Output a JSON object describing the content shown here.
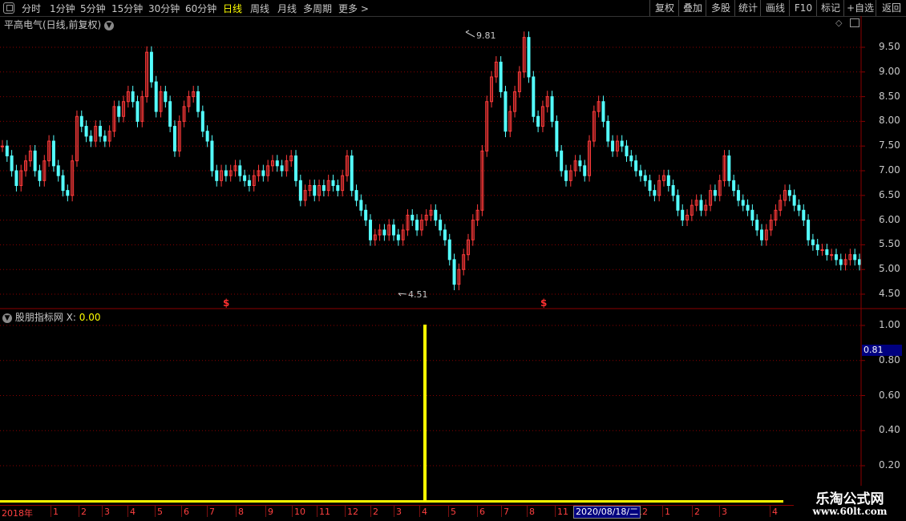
{
  "toolbar": {
    "periods": [
      "分时",
      "1分钟",
      "5分钟",
      "15分钟",
      "30分钟",
      "60分钟",
      "日线",
      "周线",
      "月线",
      "多周期",
      "更多 >"
    ],
    "active_period": "日线",
    "right_buttons": [
      "复权",
      "叠加",
      "多股",
      "统计",
      "画线",
      "F10",
      "标记",
      "+自选",
      "返回"
    ]
  },
  "main_chart": {
    "title": "平高电气(日线,前复权)",
    "y_ticks": [
      "9.50",
      "9.00",
      "8.50",
      "8.00",
      "7.50",
      "7.00",
      "6.50",
      "6.00",
      "5.50",
      "5.00",
      "4.50"
    ],
    "high_label": "9.81",
    "low_label": "4.51",
    "signal_marker": "$"
  },
  "indicator": {
    "title": "股朋指标网",
    "x_label": "X:",
    "x_value": "0.00",
    "y_ticks": [
      "1.00",
      "0.80",
      "0.60",
      "0.40",
      "0.20"
    ],
    "cursor_value": "0.81"
  },
  "x_axis": {
    "labels": [
      "2018年",
      "1",
      "2",
      "3",
      "4",
      "5",
      "6",
      "7",
      "8",
      "9",
      "10",
      "11",
      "12",
      "2",
      "3",
      "4",
      "5",
      "6",
      "7",
      "8",
      "11",
      "12",
      "1",
      "2",
      "3",
      "4"
    ],
    "cursor_date": "2020/08/18/二"
  },
  "watermark": {
    "line1": "乐淘公式网",
    "line2": "www.60lt.com"
  },
  "colors": {
    "up": "#ff3a3a",
    "down": "#54ffff",
    "grid": "#8b0000",
    "indicator": "#ffff00",
    "active": "#ffff00"
  },
  "chart_data": {
    "type": "candlestick",
    "title": "平高电气(日线,前复权)",
    "ylim": [
      4.3,
      9.9
    ],
    "close": [
      7.5,
      7.3,
      7.0,
      6.7,
      7.0,
      7.2,
      7.4,
      7.0,
      6.8,
      7.2,
      7.6,
      7.1,
      6.9,
      6.6,
      6.5,
      7.2,
      8.1,
      7.9,
      7.7,
      7.6,
      7.9,
      7.7,
      7.6,
      7.8,
      8.3,
      8.1,
      8.4,
      8.6,
      8.4,
      8.0,
      8.5,
      9.4,
      8.8,
      8.2,
      8.6,
      8.4,
      7.9,
      7.4,
      8.0,
      8.3,
      8.5,
      8.6,
      8.2,
      7.8,
      7.6,
      7.0,
      6.8,
      7.0,
      6.9,
      7.0,
      7.1,
      6.9,
      6.8,
      6.7,
      6.9,
      7.0,
      6.9,
      7.1,
      7.2,
      7.1,
      7.0,
      7.2,
      7.3,
      6.8,
      6.4,
      6.6,
      6.7,
      6.5,
      6.7,
      6.6,
      6.8,
      6.7,
      6.6,
      6.9,
      7.3,
      6.6,
      6.4,
      6.2,
      6.0,
      5.6,
      5.7,
      5.8,
      5.7,
      5.9,
      5.7,
      5.6,
      5.8,
      6.1,
      6.0,
      5.8,
      6.0,
      6.1,
      6.2,
      6.0,
      5.8,
      5.6,
      5.2,
      4.7,
      5.0,
      5.3,
      5.6,
      6.0,
      6.2,
      7.4,
      8.4,
      8.9,
      9.2,
      8.6,
      7.8,
      8.2,
      8.6,
      9.0,
      9.7,
      8.9,
      8.1,
      7.9,
      8.3,
      8.5,
      8.0,
      7.4,
      7.0,
      6.8,
      7.0,
      7.2,
      7.1,
      6.9,
      7.6,
      8.2,
      8.4,
      8.0,
      7.6,
      7.4,
      7.6,
      7.5,
      7.3,
      7.2,
      7.0,
      6.9,
      6.8,
      6.6,
      6.5,
      6.8,
      6.9,
      6.7,
      6.5,
      6.2,
      6.0,
      6.1,
      6.3,
      6.4,
      6.2,
      6.3,
      6.6,
      6.5,
      6.8,
      7.3,
      6.8,
      6.6,
      6.4,
      6.3,
      6.2,
      6.0,
      5.8,
      5.6,
      5.8,
      6.0,
      6.2,
      6.4,
      6.6,
      6.5,
      6.3,
      6.2,
      6.0,
      5.6,
      5.5,
      5.4,
      5.4,
      5.3,
      5.3,
      5.2,
      5.1,
      5.2,
      5.3,
      5.2,
      5.1
    ]
  }
}
